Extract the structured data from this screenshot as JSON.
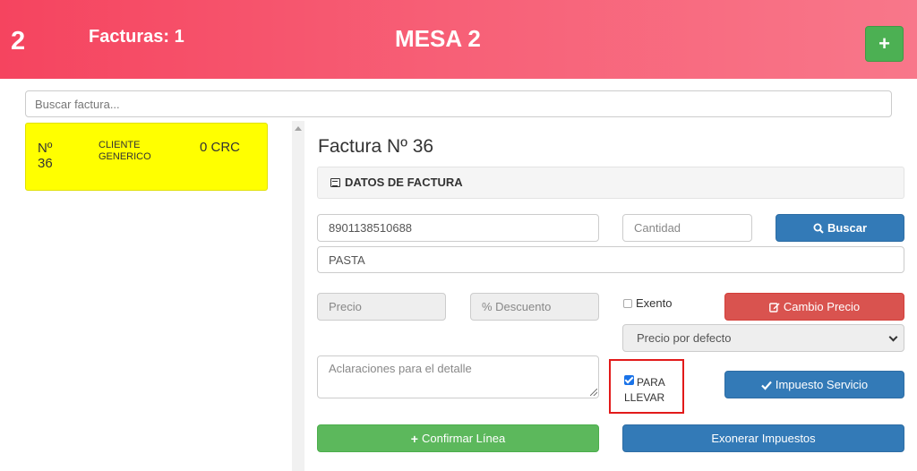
{
  "header": {
    "mesa_number": "2",
    "facturas_label": "Facturas: 1",
    "mesa_title": "MESA 2",
    "add_button": "+"
  },
  "search": {
    "placeholder": "Buscar factura..."
  },
  "invoices": [
    {
      "number": "Nº 36",
      "client": "CLIENTE GENERICO",
      "amount": "0 CRC"
    }
  ],
  "factura": {
    "title": "Factura Nº 36",
    "section_heading": "DATOS DE FACTURA",
    "barcode_value": "8901138510688",
    "cantidad_placeholder": "Cantidad",
    "buscar_label": "Buscar",
    "description_value": "PASTA",
    "precio_placeholder": "Precio",
    "descuento_placeholder": "% Descuento",
    "exento_label": "Exento",
    "cambio_precio_label": "Cambio Precio",
    "precio_select_value": "Precio por defecto",
    "aclaraciones_placeholder": "Aclaraciones para el detalle",
    "para_llevar_label": "PARA LLEVAR",
    "impuesto_servicio_label": "Impuesto Servicio",
    "confirmar_label": "Confirmar Línea",
    "exonerar_label": "Exonerar Impuestos"
  },
  "colors": {
    "header_gradient_start": "#f5445f",
    "header_gradient_end": "#f8778a",
    "invoice_card": "#ffff00",
    "primary": "#337ab7",
    "danger": "#d9534f",
    "success": "#5cb85c",
    "highlight_border": "#e21a1a"
  }
}
